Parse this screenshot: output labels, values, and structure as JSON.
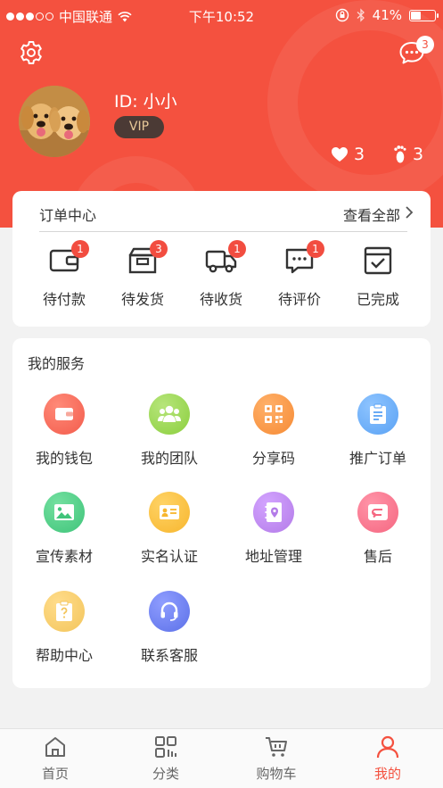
{
  "status_bar": {
    "carrier": "中国联通",
    "time": "下午10:52",
    "battery": "41%",
    "battery_level": 0.41
  },
  "header": {
    "user_id": "ID: 小小",
    "vip_label": "VIP",
    "message_badge": "3",
    "likes_count": "3",
    "footprints_count": "3"
  },
  "orders": {
    "title": "订单中心",
    "view_all": "查看全部",
    "items": [
      {
        "label": "待付款",
        "badge": "1",
        "icon": "wallet-icon"
      },
      {
        "label": "待发货",
        "badge": "3",
        "icon": "package-icon"
      },
      {
        "label": "待收货",
        "badge": "1",
        "icon": "truck-icon"
      },
      {
        "label": "待评价",
        "badge": "1",
        "icon": "comment-icon"
      },
      {
        "label": "已完成",
        "badge": "",
        "icon": "completed-icon"
      }
    ]
  },
  "services": {
    "title": "我的服务",
    "items": [
      {
        "label": "我的钱包",
        "icon": "wallet-icon",
        "color": "#f35c4c"
      },
      {
        "label": "我的团队",
        "icon": "team-icon",
        "color": "#8ccf3f"
      },
      {
        "label": "分享码",
        "icon": "qrcode-icon",
        "color": "#f68b35"
      },
      {
        "label": "推广订单",
        "icon": "clipboard-icon",
        "color": "#5aa2f4"
      },
      {
        "label": "宣传素材",
        "icon": "image-icon",
        "color": "#3fc47a"
      },
      {
        "label": "实名认证",
        "icon": "id-card-icon",
        "color": "#f7b62e"
      },
      {
        "label": "地址管理",
        "icon": "address-book-icon",
        "color": "#b37be8"
      },
      {
        "label": "售后",
        "icon": "return-icon",
        "color": "#f56781"
      },
      {
        "label": "帮助中心",
        "icon": "help-icon",
        "color": "#f3c55c"
      },
      {
        "label": "联系客服",
        "icon": "headset-icon",
        "color": "#5c71e8"
      }
    ]
  },
  "tabbar": {
    "items": [
      {
        "label": "首页",
        "icon": "home-icon"
      },
      {
        "label": "分类",
        "icon": "category-icon"
      },
      {
        "label": "购物车",
        "icon": "cart-icon"
      },
      {
        "label": "我的",
        "icon": "user-icon",
        "active": true
      }
    ]
  },
  "colors": {
    "brand": "#f4513f",
    "badge": "#f24d40",
    "vip_bg": "#4b3a35",
    "vip_text": "#e8c898"
  }
}
